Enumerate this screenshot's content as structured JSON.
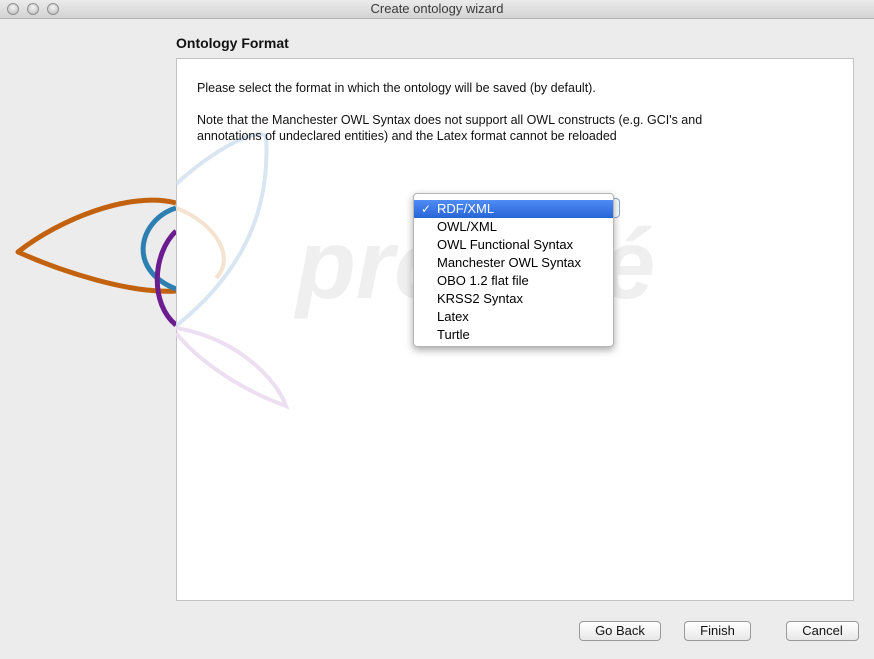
{
  "window": {
    "title": "Create ontology wizard"
  },
  "page": {
    "heading": "Ontology Format",
    "instruction": "Please select the format in which the ontology will be saved (by default).",
    "note_line1": "Note that the Manchester OWL Syntax does not support all OWL constructs (e.g. GCI's and",
    "note_line2": "annotations of undeclared entities) and the Latex format cannot be reloaded"
  },
  "format_menu": {
    "selected": "RDF/XML",
    "check_mark": "✓",
    "options": [
      "RDF/XML",
      "OWL/XML",
      "OWL Functional Syntax",
      "Manchester OWL Syntax",
      "OBO 1.2 flat file",
      "KRSS2 Syntax",
      "Latex",
      "Turtle"
    ]
  },
  "watermark": {
    "logo": "protégé"
  },
  "buttons": {
    "back": "Go Back",
    "finish": "Finish",
    "cancel": "Cancel"
  },
  "colors": {
    "selection": "#3478e6",
    "logo_orange": "#c2620f",
    "logo_blue": "#2c7fb0",
    "logo_purple": "#6b1d8f"
  }
}
